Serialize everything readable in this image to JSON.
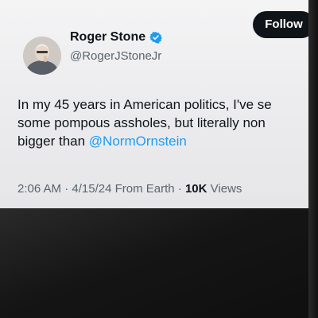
{
  "post": {
    "follow_label": "Follow",
    "author_name": "Roger Stone",
    "author_handle": "@RogerJStoneJr",
    "text_line1": "In my 45 years in American politics, I've se",
    "text_line2": "some pompous assholes, but literally non",
    "text_line3_prefix": "bigger than ",
    "mention": "@NormOrnstein",
    "time": "2:06 AM",
    "date": "4/15/24",
    "source": "From Earth",
    "separator": "·",
    "views_count": "10K",
    "views_label": "Views"
  },
  "colors": {
    "mention": "#1d9bf0",
    "verified_badge": "#1d9bf0",
    "follow_bg": "#0f1419",
    "muted_text": "#5b646d"
  },
  "icons": {
    "verified": "verified-badge-icon"
  }
}
